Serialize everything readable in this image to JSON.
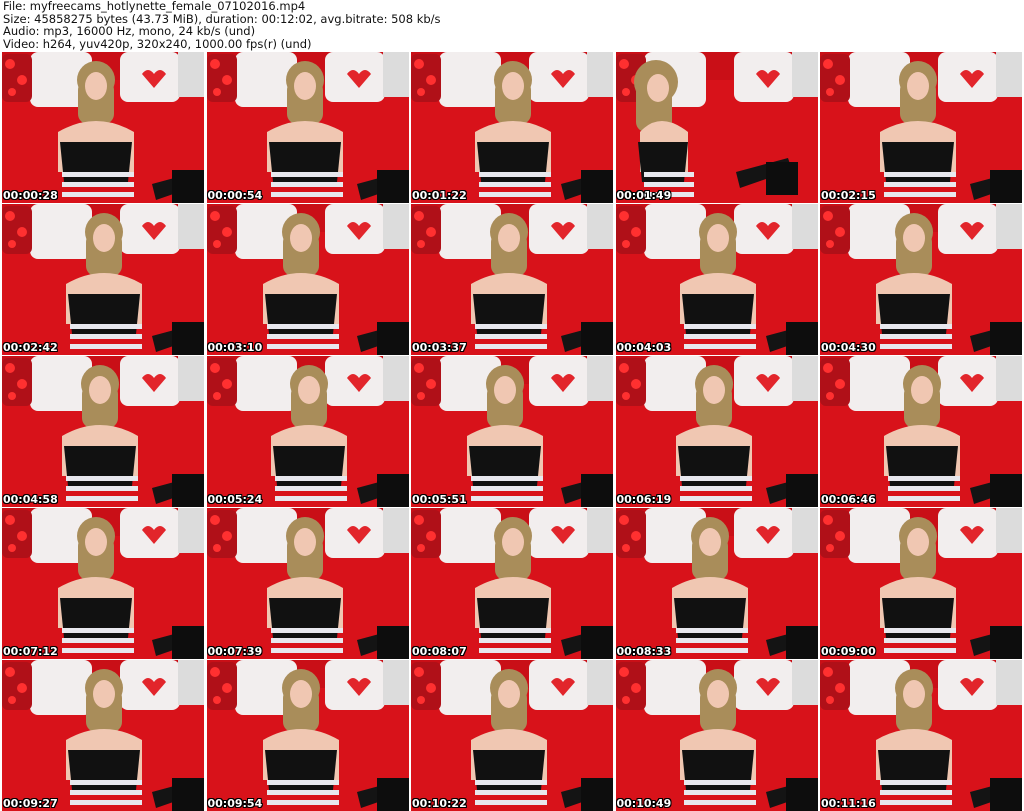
{
  "header": {
    "file": "File: myfreecams_hotlynette_female_07102016.mp4",
    "size": "Size: 45858275 bytes (43.73 MiB), duration: 00:12:02, avg.bitrate: 508 kb/s",
    "audio": "Audio: mp3, 16000 Hz, mono, 24 kb/s (und)",
    "video": "Video: h264, yuv420p, 320x240, 1000.00 fps(r) (und)"
  },
  "thumbnails": [
    {
      "time": "00:00:28"
    },
    {
      "time": "00:00:54"
    },
    {
      "time": "00:01:22"
    },
    {
      "time": "00:01:49"
    },
    {
      "time": "00:02:15"
    },
    {
      "time": "00:02:42"
    },
    {
      "time": "00:03:10"
    },
    {
      "time": "00:03:37"
    },
    {
      "time": "00:04:03"
    },
    {
      "time": "00:04:30"
    },
    {
      "time": "00:04:58"
    },
    {
      "time": "00:05:24"
    },
    {
      "time": "00:05:51"
    },
    {
      "time": "00:06:19"
    },
    {
      "time": "00:06:46"
    },
    {
      "time": "00:07:12"
    },
    {
      "time": "00:07:39"
    },
    {
      "time": "00:08:07"
    },
    {
      "time": "00:08:33"
    },
    {
      "time": "00:09:00"
    },
    {
      "time": "00:09:27"
    },
    {
      "time": "00:09:54"
    },
    {
      "time": "00:10:22"
    },
    {
      "time": "00:10:49"
    },
    {
      "time": "00:11:16"
    }
  ],
  "colors": {
    "background": "#ffffff",
    "sofa_red": "#d8121a",
    "pillow_white": "#f2eeee",
    "hair": "#a98d5a",
    "skin": "#f0c7b2",
    "top_black": "#111111",
    "stripes": "#e8e8ee"
  }
}
